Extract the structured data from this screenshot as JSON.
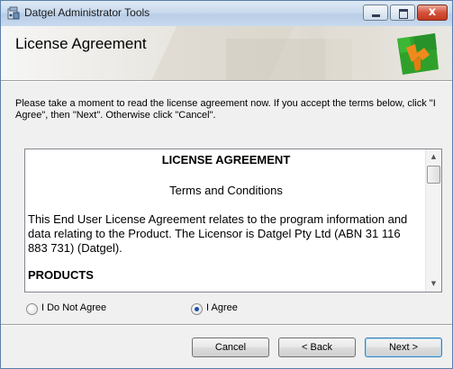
{
  "window": {
    "title": "Datgel Administrator Tools",
    "close_label": "x"
  },
  "banner": {
    "title": "License Agreement"
  },
  "intro_text": "Please take a moment to read the license agreement now. If you accept the terms below, click \"I Agree\", then \"Next\". Otherwise click \"Cancel\".",
  "license": {
    "heading": "LICENSE AGREEMENT",
    "subheading": "Terms and Conditions",
    "paragraph": "This End User License Agreement relates to the program information and data relating to the Product.  The Licensor is Datgel Pty Ltd (ABN 31 116 883 731) (Datgel).",
    "section": "PRODUCTS"
  },
  "radio": {
    "disagree_label": "I Do Not Agree",
    "agree_label": "I Agree",
    "selected": "agree"
  },
  "buttons": {
    "cancel": "Cancel",
    "back": "< Back",
    "next": "Next >"
  },
  "icons": {
    "app": "installer-icon",
    "logo": "datgel-logo-icon",
    "scroll_up": "scroll-up-arrow-icon",
    "scroll_down": "scroll-down-arrow-icon"
  },
  "colors": {
    "logo_green": "#2fa12a",
    "logo_orange": "#f08a1c",
    "default_button_border": "#3c7fb1",
    "radio_selected": "#1a50a8"
  }
}
